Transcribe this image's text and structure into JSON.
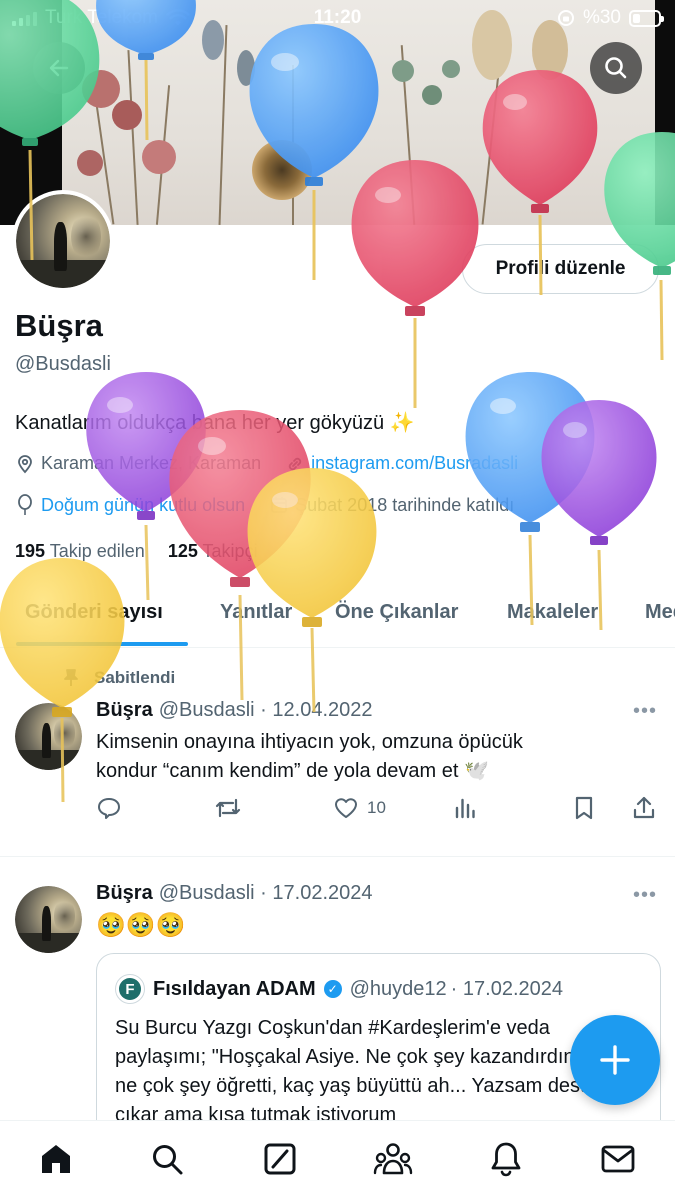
{
  "status_bar": {
    "carrier": "Turk Telekom",
    "time": "11:20",
    "battery": "%30",
    "battery_level": 0.3
  },
  "header": {
    "back_icon": "arrow-left-icon",
    "search_icon": "search-icon"
  },
  "profile": {
    "name": "Büşra",
    "handle": "@Busdasli",
    "edit_label": "Profili düzenle",
    "bio": "Kanatlarım oldukça bana her yer gökyüzü ✨",
    "location": "Karaman Merkez, Karaman",
    "website": "instagram.com/Busradasli",
    "birthday": "Doğum günün kutlu olsun",
    "joined": "Şubat 2018 tarihinde katıldı",
    "following_count": "195",
    "following_label": "Takip edilen",
    "followers_count": "125",
    "followers_label": "Takipçi"
  },
  "tabs": [
    {
      "label": "Gönderi sayısı",
      "active": true
    },
    {
      "label": "Yanıtlar"
    },
    {
      "label": "Öne Çıkanlar"
    },
    {
      "label": "Makaleler"
    },
    {
      "label": "Medya"
    }
  ],
  "posts": [
    {
      "pinned_label": "Sabitlendi",
      "author": "Büşra",
      "handle": "@Busdasli",
      "date": "· 12.04.2022",
      "text_line1": "Kimsenin onayına ihtiyacın yok, omzuna öpücük",
      "text_line2": "kondur “canım kendim” de yola devam et 🕊️",
      "likes": "10"
    },
    {
      "author": "Büşra",
      "handle": "@Busdasli",
      "date": "· 17.02.2024",
      "text": "🥹🥹🥹",
      "quote": {
        "author": "Fısıldayan ADAM",
        "handle": "@huyde12",
        "date": "· 17.02.2024",
        "text": "Su Burcu Yazgı Coşkun'dan #Kardeşlerim'e veda paylaşımı; \"Hoşçakal Asiye. Ne çok şey kazandırdın bana, ne çok şey öğretti, kaç yaş büyüttü ah... Yazsam destan çıkar ama kısa tutmak istiyorum"
      }
    }
  ],
  "bottom_nav": [
    "home-icon",
    "search-icon",
    "grok-icon",
    "communities-icon",
    "notifications-icon",
    "messages-icon"
  ],
  "colors": {
    "accent": "#1d9bf0",
    "text": "#0f1419",
    "muted": "#536471"
  }
}
